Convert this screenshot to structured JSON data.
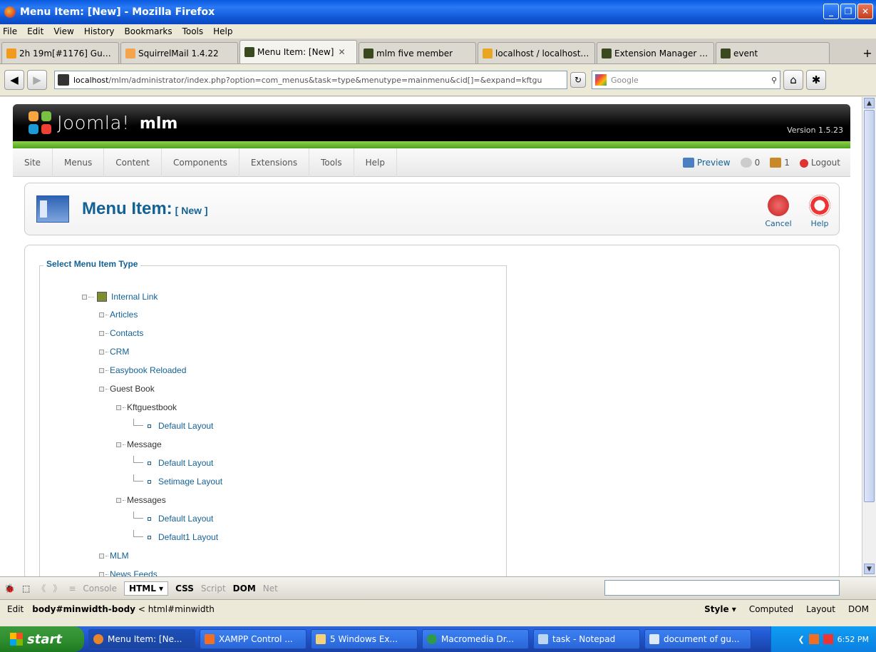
{
  "window": {
    "title": "Menu Item: [New] - Mozilla Firefox"
  },
  "menubar": [
    "File",
    "Edit",
    "View",
    "History",
    "Bookmarks",
    "Tools",
    "Help"
  ],
  "tabs": [
    {
      "label": "2h 19m[#1176] Gues...",
      "color": "#f29a1a"
    },
    {
      "label": "SquirrelMail 1.4.22",
      "color": "#f4a44d"
    },
    {
      "label": "Menu Item: [New]",
      "color": "#3a4a1e",
      "active": true
    },
    {
      "label": "mlm five member",
      "color": "#3a4a1e"
    },
    {
      "label": "localhost / localhost /...",
      "color": "#e8a623"
    },
    {
      "label": "Extension Manager : ...",
      "color": "#3a4a1e"
    },
    {
      "label": "event",
      "color": "#3a4a1e"
    }
  ],
  "address": {
    "host": "localhost",
    "path": "/mlm/administrator/index.php?option=com_menus&task=type&menutype=mainmenu&cid[]=&expand=kftgu",
    "search_placeholder": "Google"
  },
  "joomla": {
    "brand": "Joomla!",
    "site_name": "mlm",
    "version": "Version 1.5.23",
    "menu": [
      "Site",
      "Menus",
      "Content",
      "Components",
      "Extensions",
      "Tools",
      "Help"
    ],
    "status": {
      "preview": "Preview",
      "messages": "0",
      "users": "1",
      "logout": "Logout"
    },
    "toolbar": {
      "title": "Menu Item:",
      "title_suffix": "[ New ]",
      "cancel": "Cancel",
      "help": "Help"
    },
    "legend": "Select Menu Item Type",
    "tree": {
      "root": "Internal Link",
      "items": [
        "Articles",
        "Contacts",
        "CRM",
        "Easybook Reloaded",
        "Guest Book",
        "Kftguestbook",
        "Default Layout",
        "Message",
        "Default Layout",
        "Setimage Layout",
        "Messages",
        "Default Layout",
        "Default1 Layout",
        "MLM",
        "News Feeds"
      ]
    }
  },
  "firebug": {
    "tabs": [
      "Console",
      "HTML ▾",
      "CSS",
      "Script",
      "DOM",
      "Net"
    ],
    "edit": "Edit",
    "breadcrumb_bold": "body#minwidth-body",
    "breadcrumb_rest": "html#minwidth",
    "right_tabs": [
      "Style ▾",
      "Computed",
      "Layout",
      "DOM"
    ]
  },
  "taskbar": {
    "start": "start",
    "tasks": [
      "Menu Item: [Ne...",
      "XAMPP Control ...",
      "5 Windows Ex...",
      "Macromedia Dr...",
      "task - Notepad",
      "document of gu..."
    ],
    "clock": "6:52 PM"
  }
}
